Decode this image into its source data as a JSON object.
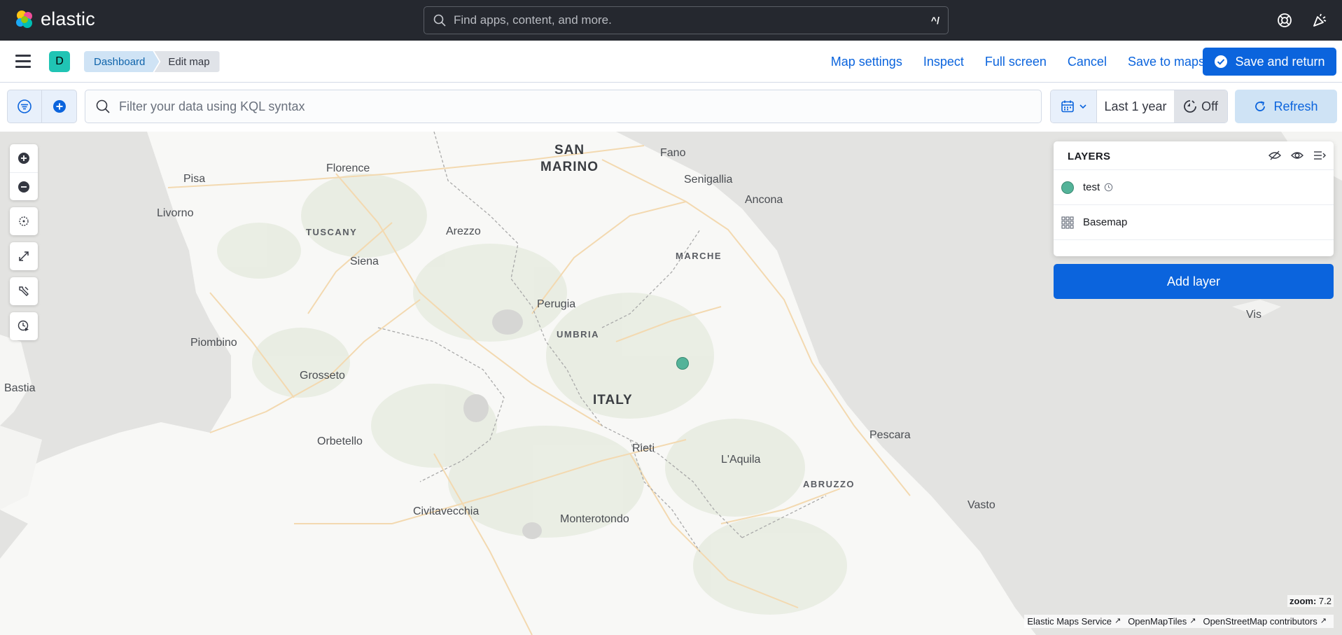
{
  "header": {
    "brand": "elastic",
    "search_placeholder": "Find apps, content, and more.",
    "search_shortcut": "^/",
    "icons": [
      "help-icon",
      "newsfeed-icon"
    ]
  },
  "subheader": {
    "space_initial": "D",
    "breadcrumbs": [
      "Dashboard",
      "Edit map"
    ],
    "links": [
      "Map settings",
      "Inspect",
      "Full screen",
      "Cancel",
      "Save to maps"
    ],
    "primary_action": "Save and return"
  },
  "query": {
    "placeholder": "Filter your data using KQL syntax",
    "time_range": "Last 1 year",
    "auto_refresh": "Off",
    "refresh_label": "Refresh"
  },
  "map": {
    "labels": {
      "san_marino": "SAN\nMARINO",
      "fano": "Fano",
      "florence": "Florence",
      "pisa": "Pisa",
      "senigallia": "Senigallia",
      "ancona": "Ancona",
      "livorno": "Livorno",
      "tuscany": "TUSCANY",
      "arezzo": "Arezzo",
      "marche": "MARCHE",
      "siena": "Siena",
      "perugia": "Perugia",
      "umbria": "UMBRIA",
      "vis": "Vis",
      "piombino": "Piombino",
      "bastia": "Bastia",
      "grosseto": "Grosseto",
      "italy": "ITALY",
      "pescara": "Pescara",
      "orbetello": "Orbetello",
      "rieti": "Rieti",
      "laquila": "L'Aquila",
      "abruzzo": "ABRUZZO",
      "civitavecchia": "Civitavecchia",
      "vasto": "Vasto",
      "monterotondo": "Monterotondo"
    },
    "layers_title": "LAYERS",
    "layers": [
      {
        "name": "test",
        "color": "#54b399"
      },
      {
        "name": "Basemap",
        "color": "#69707d"
      }
    ],
    "add_layer": "Add layer",
    "zoom_label": "zoom:",
    "zoom_value": "7.2",
    "attribution": [
      "Elastic Maps Service",
      "OpenMapTiles",
      "OpenStreetMap contributors"
    ]
  },
  "colors": {
    "header_bg": "#25282f",
    "primary": "#0b64dd",
    "point": "#54b399"
  }
}
